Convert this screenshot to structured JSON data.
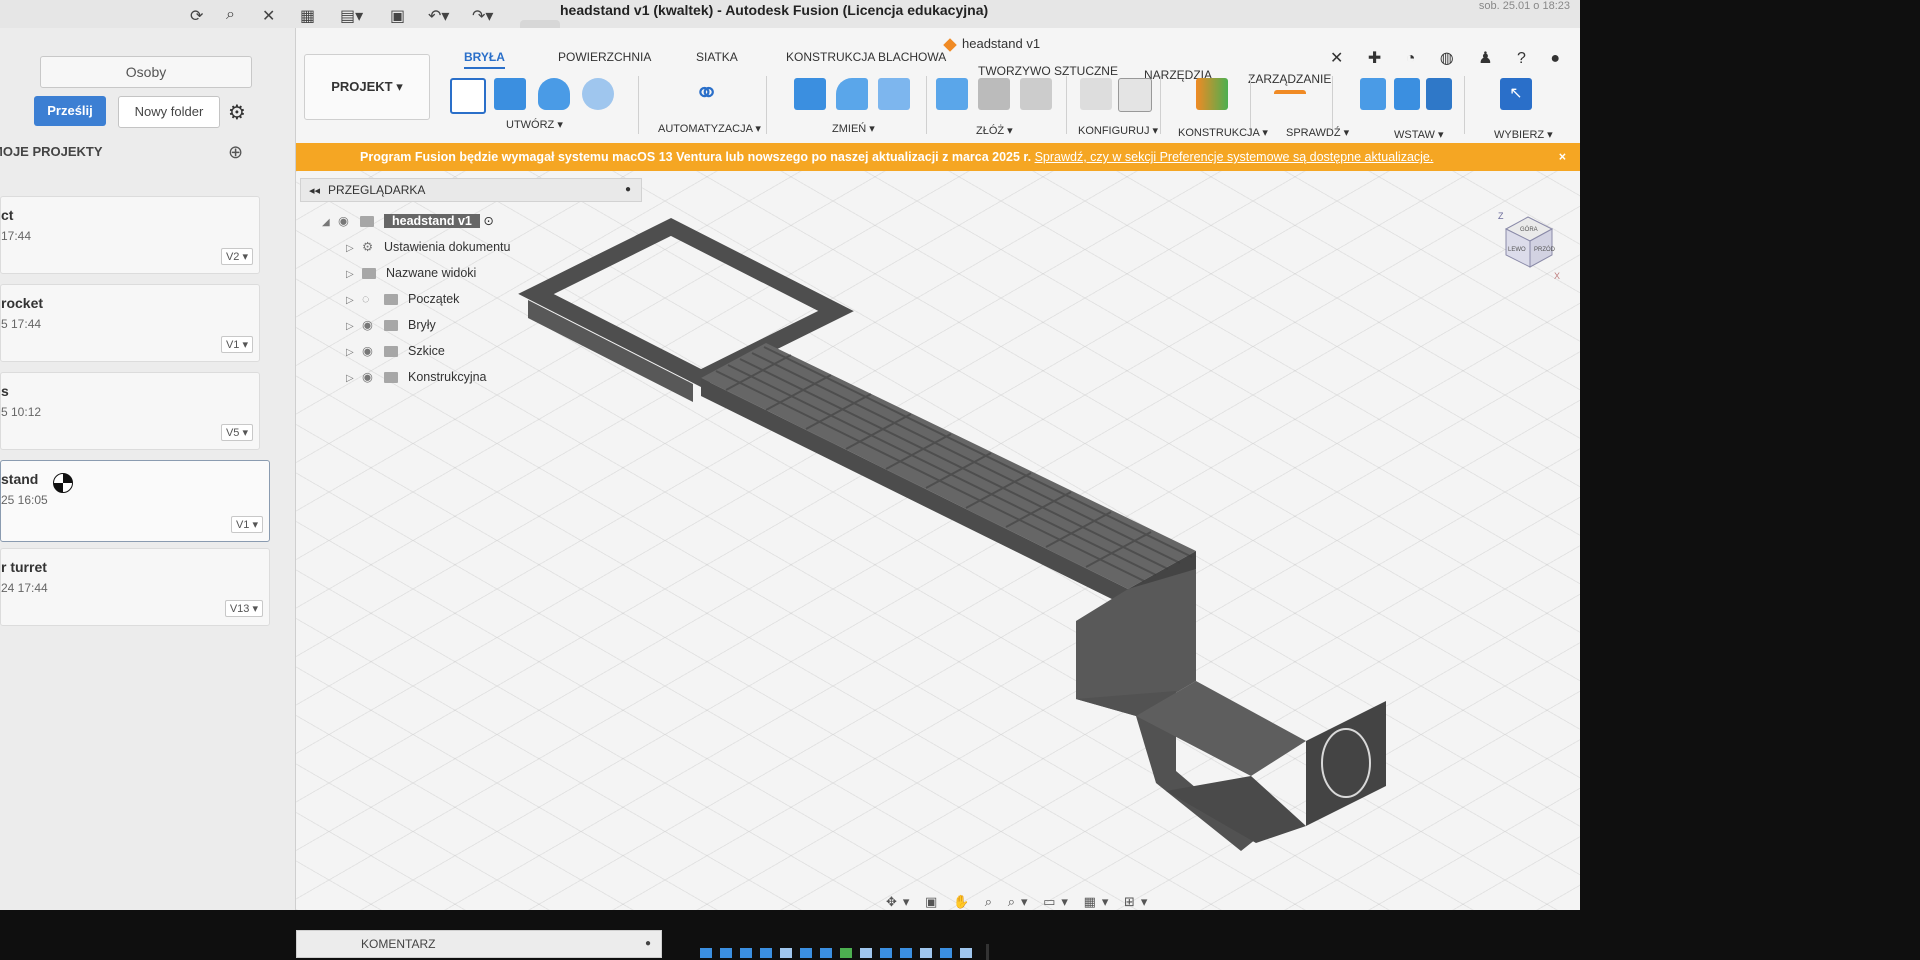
{
  "window": {
    "title": "headstand v1 (kwaltek) - Autodesk Fusion (Licencja edukacyjna)",
    "status_right": "sob. 25.01 o 18:23"
  },
  "left_panel": {
    "tab_people": "Osoby",
    "upload_button": "Prześlij",
    "new_folder_button": "Nowy folder",
    "section_title": "MOJE PROJEKTY",
    "projects": [
      {
        "name": "ct",
        "date": "17:44",
        "version": "V2 ▾"
      },
      {
        "name": "rocket",
        "date": "5 17:44",
        "version": "V1 ▾"
      },
      {
        "name": "s",
        "date": "5 10:12",
        "version": "V5 ▾"
      },
      {
        "name": "stand",
        "date": "25 16:05",
        "version": "V1 ▾"
      },
      {
        "name": "r turret",
        "date": "24 17:44",
        "version": "V13 ▾"
      }
    ]
  },
  "toolbar": {
    "project_button": "PROJEKT ▾",
    "document_tab": "headstand v1",
    "tabs": [
      "BRYŁA",
      "POWIERZCHNIA",
      "SIATKA",
      "KONSTRUKCJA BLACHOWA",
      "TWORZYWO SZTUCZNE",
      "NARZĘDZIA",
      "ZARZĄDZANIE"
    ],
    "groups": [
      "UTWÓRZ ▾",
      "AUTOMATYZACJA ▾",
      "ZMIEŃ ▾",
      "ZŁÓŻ ▾",
      "KONFIGURUJ ▾",
      "KONSTRUKCJA ▾",
      "SPRAWDŹ ▾",
      "WSTAW ▾",
      "WYBIERZ ▾"
    ]
  },
  "banner": {
    "message": "Program Fusion będzie wymagał systemu macOS 13 Ventura lub nowszego po naszej aktualizacji z marca 2025 r.",
    "link": "Sprawdź, czy w sekcji Preferencje systemowe są dostępne aktualizacje.",
    "close": "×"
  },
  "browser": {
    "title": "PRZEGLĄDARKA",
    "root": "headstand v1",
    "items": [
      "Ustawienia dokumentu",
      "Nazwane widoki",
      "Początek",
      "Bryły",
      "Szkice",
      "Konstrukcyjna"
    ]
  },
  "viewcube": {
    "top": "GÓRA",
    "front": "PRZÓD",
    "left": "LEWO",
    "axis_z": "Z",
    "axis_x": "X"
  },
  "comment_panel": {
    "label": "KOMENTARZ"
  },
  "colors": {
    "accent": "#2a6fc9",
    "banner": "#f5a623",
    "model": "#5c5c5c",
    "upload": "#3c7fd3"
  }
}
